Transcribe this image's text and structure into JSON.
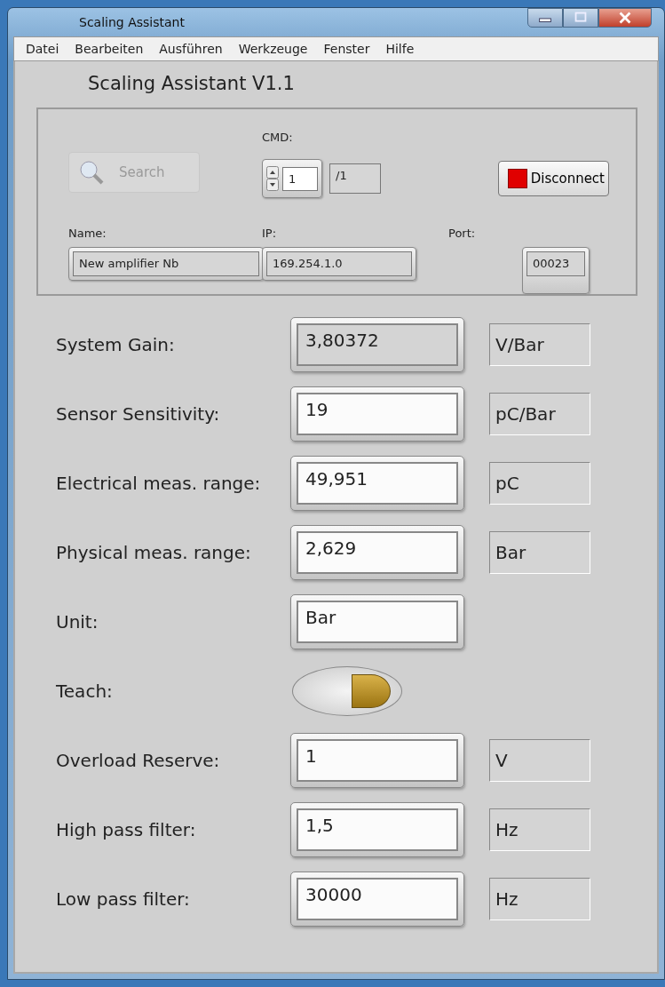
{
  "window": {
    "title": "Scaling Assistant"
  },
  "menu": [
    "Datei",
    "Bearbeiten",
    "Ausführen",
    "Werkzeuge",
    "Fenster",
    "Hilfe"
  ],
  "heading": "Scaling Assistant V1.1",
  "connection": {
    "search": {
      "label": "Search",
      "disabled": true
    },
    "cmd": {
      "label": "CMD:",
      "value": "1",
      "total": "/1"
    },
    "disconnect": {
      "label": "Disconnect"
    },
    "name": {
      "label": "Name:",
      "value": "New amplifier Nb"
    },
    "ip": {
      "label": "IP:",
      "value": "169.254.1.0"
    },
    "port": {
      "label": "Port:",
      "value": "00023"
    }
  },
  "params": [
    {
      "kind": "field",
      "label": "System Gain:",
      "value": "3,80372",
      "readonly": true,
      "unit": "V/Bar"
    },
    {
      "kind": "field",
      "label": "Sensor Sensitivity:",
      "value": "19",
      "readonly": false,
      "unit": "pC/Bar"
    },
    {
      "kind": "field",
      "label": "Electrical meas. range:",
      "value": "49,951",
      "readonly": false,
      "unit": "pC"
    },
    {
      "kind": "field",
      "label": "Physical meas. range:",
      "value": "2,629",
      "readonly": false,
      "unit": "Bar"
    },
    {
      "kind": "field",
      "label": "Unit:",
      "value": "Bar",
      "readonly": false
    },
    {
      "kind": "toggle",
      "label": "Teach:",
      "on": true
    },
    {
      "kind": "field",
      "label": "Overload Reserve:",
      "value": "1",
      "readonly": false,
      "unit": "V"
    },
    {
      "kind": "field",
      "label": "High pass filter:",
      "value": "1,5",
      "readonly": false,
      "unit": "Hz"
    },
    {
      "kind": "field",
      "label": "Low pass filter:",
      "value": "30000",
      "readonly": false,
      "unit": "Hz"
    }
  ]
}
